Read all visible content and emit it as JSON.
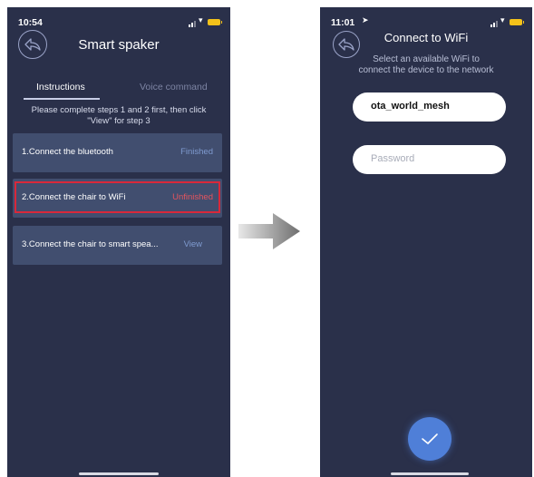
{
  "colors": {
    "screen_bg": "#2a304a",
    "card_bg": "#414e6f",
    "finished": "#7f9bd0",
    "unfinished": "#e4545e",
    "view": "#7f9bd0",
    "highlight": "#d8283a",
    "confirm_button": "#4f7fd8"
  },
  "left_screen": {
    "status_time": "10:54",
    "title": "Smart spaker",
    "tabs": [
      {
        "label": "Instructions",
        "active": true
      },
      {
        "label": "Voice command",
        "active": false
      }
    ],
    "info_line1": "Please complete steps 1 and 2 first, then click",
    "info_line2": "\"View\" for step 3",
    "steps": [
      {
        "label": "1.Connect the bluetooth",
        "status": "Finished"
      },
      {
        "label": "2.Connect the chair to WiFi",
        "status": "Unfinished"
      },
      {
        "label": "3.Connect the chair to smart spea...",
        "status": "View"
      }
    ]
  },
  "right_screen": {
    "status_time": "11:01",
    "title": "Connect to WiFi",
    "subtitle_line1": "Select an available WiFi to",
    "subtitle_line2": "connect the device to the network",
    "wifi_name": "ota_world_mesh",
    "password_placeholder": "Password"
  },
  "icons": {
    "back": "back-arrow-icon",
    "confirm": "checkmark-icon",
    "transition": "right-arrow-icon"
  }
}
